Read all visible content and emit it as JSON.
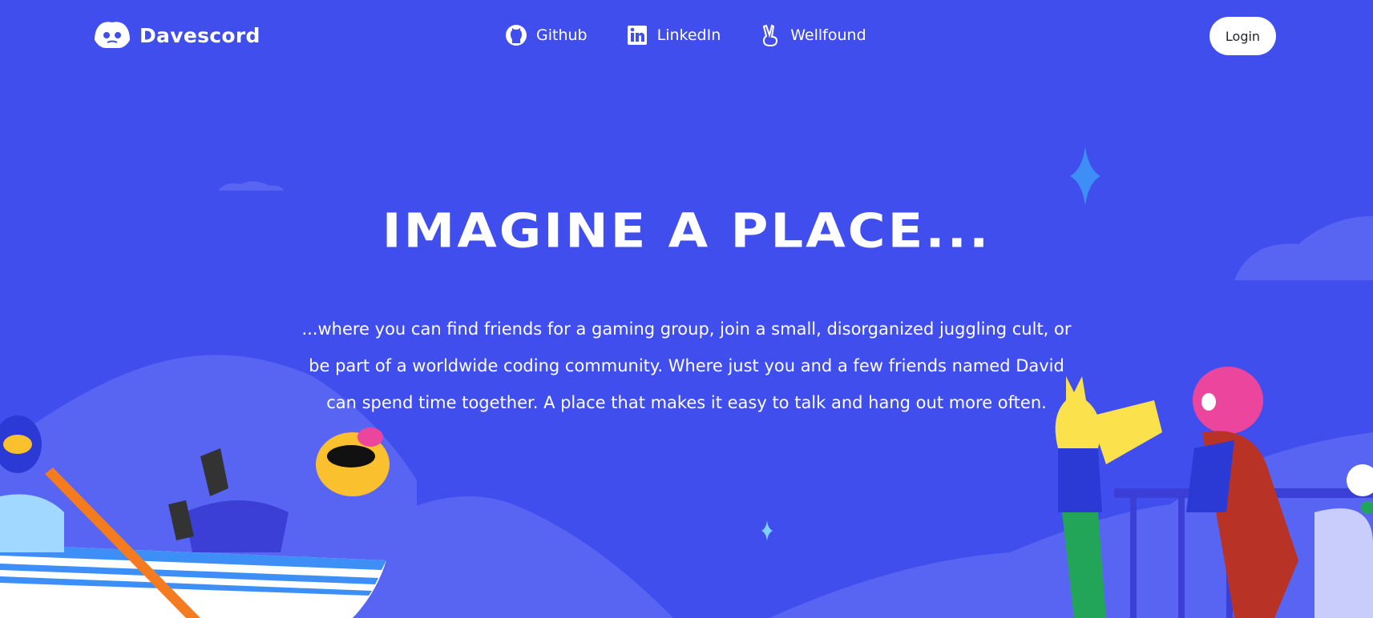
{
  "header": {
    "brand_name": "Davescord",
    "nav_links": [
      {
        "label": "Github",
        "icon": "github-icon"
      },
      {
        "label": "LinkedIn",
        "icon": "linkedin-icon"
      },
      {
        "label": "Wellfound",
        "icon": "wellfound-icon"
      }
    ],
    "login_label": "Login"
  },
  "hero": {
    "title": "IMAGINE A PLACE...",
    "description": "...where you can find friends for a gaming group, join a small, disorganized juggling cult, or be part of a worldwide coding community. Where just you and a few friends named David can spend time together. A place that makes it easy to talk and hang out more often."
  },
  "colors": {
    "background": "#404eed",
    "hill": "#5865f2",
    "button_bg": "#ffffff",
    "button_text": "#23272a",
    "sparkle_blue": "#3e8ef7",
    "sparkle_pink": "#ff73fa"
  }
}
